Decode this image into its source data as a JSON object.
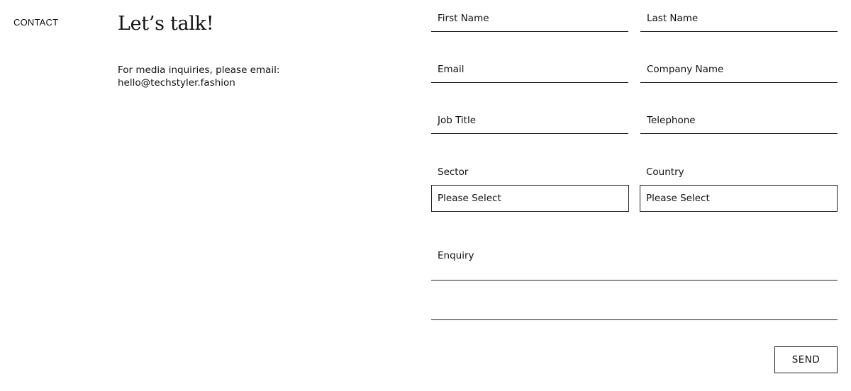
{
  "left": {
    "section_label": "CONTACT",
    "heading": "Let’s talk!",
    "media_line1": "For media inquiries, please email:",
    "media_email": "hello@techstyler.fashion"
  },
  "form": {
    "first_name": "First Name",
    "last_name": "Last Name",
    "email": "Email",
    "company_name": "Company Name",
    "job_title": "Job Title",
    "telephone": "Telephone",
    "sector_label": "Sector",
    "sector_value": "Please Select",
    "country_label": "Country",
    "country_value": "Please Select",
    "enquiry": "Enquiry",
    "send": "SEND"
  }
}
